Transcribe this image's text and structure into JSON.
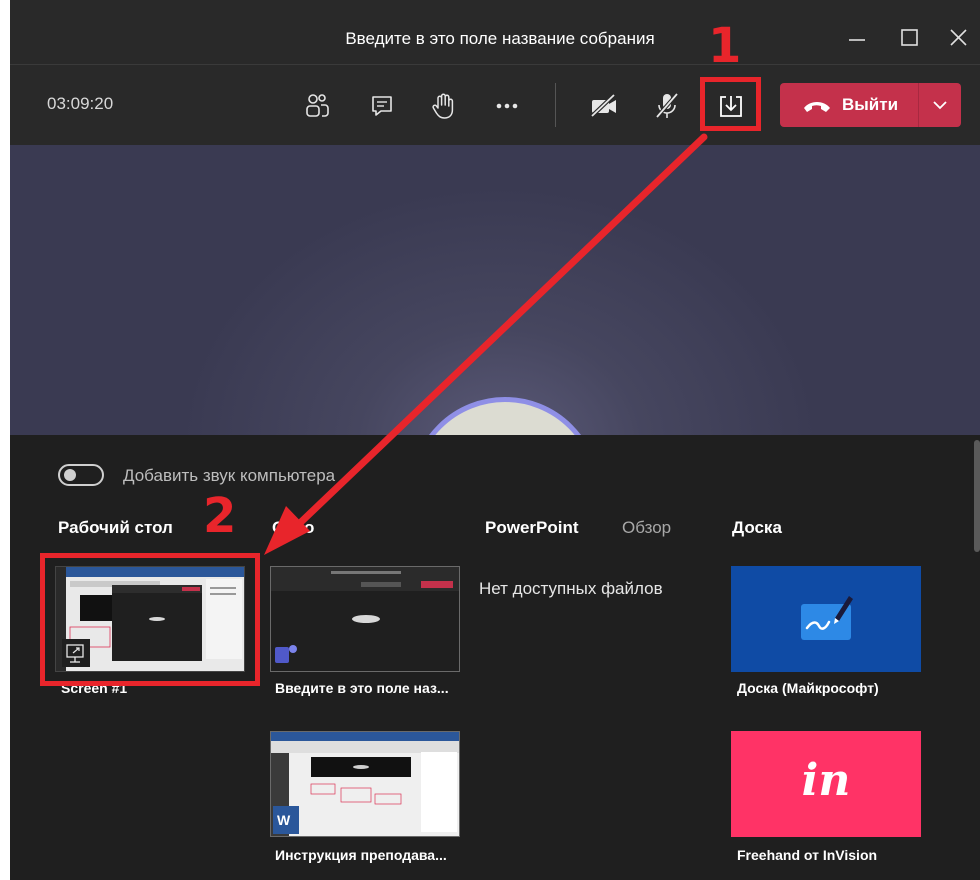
{
  "window": {
    "title": "Введите в это поле название собрания",
    "controls": [
      "minimize-icon",
      "maximize-icon",
      "close-icon"
    ]
  },
  "toolbar": {
    "timer": "03:09:20",
    "icons": [
      "people-icon",
      "chat-icon",
      "raise-hand-icon",
      "more-icon",
      "camera-off-icon",
      "mic-off-icon",
      "share-tray-icon"
    ],
    "leave_label": "Выйти"
  },
  "tray": {
    "audio_toggle_label": "Добавить звук компьютера",
    "sections": {
      "desktop": "Рабочий стол",
      "window": "Окно",
      "powerpoint": "PowerPoint",
      "browse": "Обзор",
      "whiteboard": "Доска"
    },
    "no_files": "Нет доступных файлов",
    "desktop_items": [
      {
        "label": "Screen #1"
      }
    ],
    "window_items": [
      {
        "label": "Введите в это поле наз...",
        "app_icon": "teams-icon"
      },
      {
        "label": "Инструкция преподава...",
        "app_icon": "word-icon"
      }
    ],
    "whiteboard_items": [
      {
        "label": "Доска (Майкрософт)",
        "color": "#0f4ba5"
      },
      {
        "label": "Freehand от InVision",
        "color": "#ff3366",
        "logo_text": "in"
      }
    ]
  },
  "annotations": {
    "step1": "1",
    "step2": "2",
    "color": "#e8252b"
  }
}
